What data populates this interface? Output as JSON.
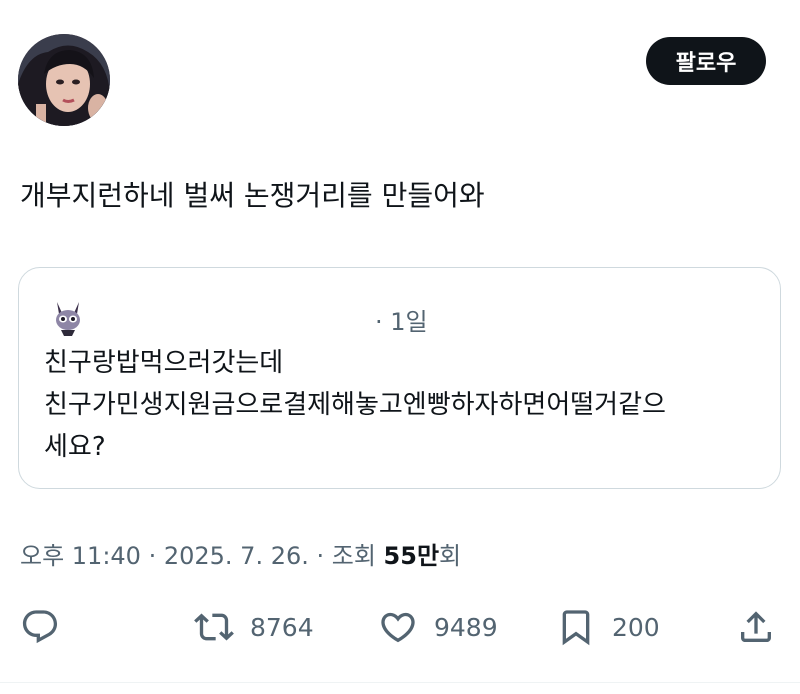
{
  "tweet": {
    "follow_label": "팔로우",
    "text": "개부지런하네 벌써 논쟁거리를 만들어와",
    "quoted": {
      "time": "· 1일",
      "lines": [
        "친구랑밥먹으러갓는데",
        "친구가민생지원금으로결제해놓고엔빵하자하면어떨거같으",
        "세요?"
      ]
    },
    "meta": {
      "timestamp": "오후 11:40 · 2025. 7. 26. · 조회 ",
      "views_number": "55만",
      "views_suffix": "회"
    },
    "actions": {
      "replies_icon": "reply-icon",
      "retweet_icon": "retweet-icon",
      "retweets": "8764",
      "like_icon": "heart-icon",
      "likes": "9489",
      "bookmark_icon": "bookmark-icon",
      "bookmarks": "200",
      "share_icon": "share-icon"
    }
  }
}
